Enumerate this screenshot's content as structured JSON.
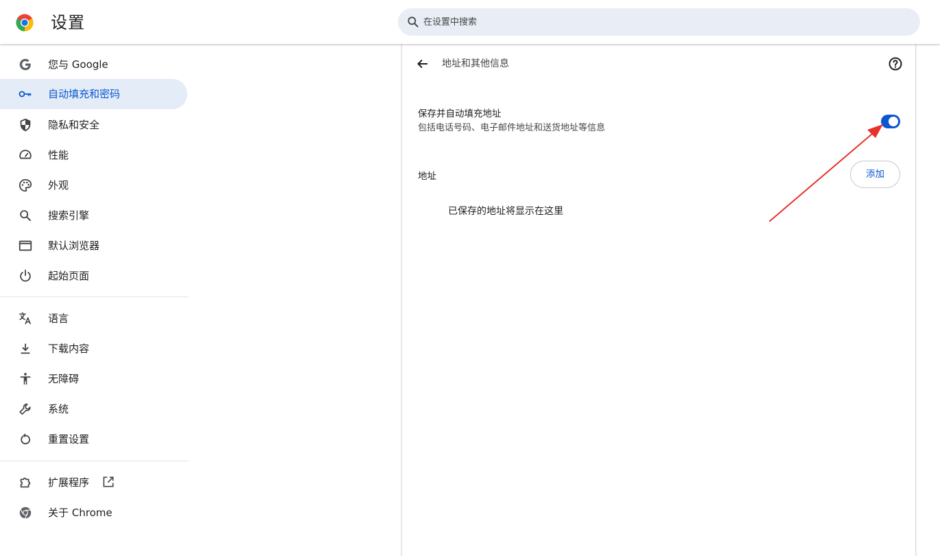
{
  "header": {
    "title": "设置",
    "search_placeholder": "在设置中搜索"
  },
  "sidebar": {
    "items": [
      {
        "label": "您与 Google",
        "icon": "google-icon"
      },
      {
        "label": "自动填充和密码",
        "icon": "key-icon",
        "active": true
      },
      {
        "label": "隐私和安全",
        "icon": "shield-icon"
      },
      {
        "label": "性能",
        "icon": "speedometer-icon"
      },
      {
        "label": "外观",
        "icon": "palette-icon"
      },
      {
        "label": "搜索引擎",
        "icon": "search-icon"
      },
      {
        "label": "默认浏览器",
        "icon": "browser-window-icon"
      },
      {
        "label": "起始页面",
        "icon": "power-icon"
      },
      {
        "label": "语言",
        "icon": "translate-icon"
      },
      {
        "label": "下载内容",
        "icon": "download-icon"
      },
      {
        "label": "无障碍",
        "icon": "accessibility-icon"
      },
      {
        "label": "系统",
        "icon": "wrench-icon"
      },
      {
        "label": "重置设置",
        "icon": "reset-icon"
      },
      {
        "label": "扩展程序",
        "icon": "puzzle-icon"
      },
      {
        "label": "关于 Chrome",
        "icon": "chrome-icon"
      }
    ]
  },
  "main": {
    "subpage_title": "地址和其他信息",
    "save_toggle": {
      "title": "保存并自动填充地址",
      "subtitle": "包括电话号码、电子邮件地址和送货地址等信息",
      "on": true
    },
    "addresses_label": "地址",
    "add_button": "添加",
    "empty_message": "已保存的地址将显示在这里"
  },
  "colors": {
    "accent": "#0b57d0",
    "active_nav_bg": "#e4ecf8",
    "search_bg": "#e9eef6",
    "annotation_arrow": "#e8312a"
  }
}
